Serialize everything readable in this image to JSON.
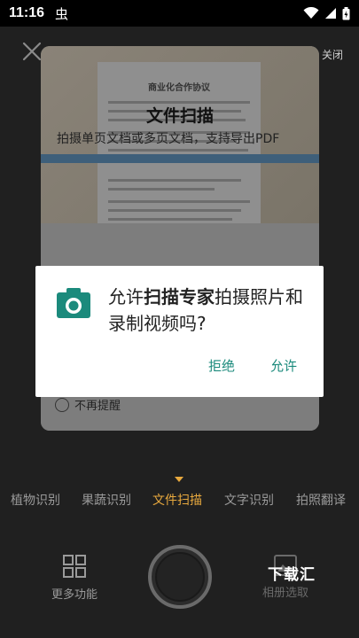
{
  "status_bar": {
    "time": "11:16",
    "bug_icon": "虫"
  },
  "top_bar": {
    "flash_label": "关闭"
  },
  "tutorial": {
    "doc_title": "商业化合作协议",
    "heading": "文件扫描",
    "description": "拍摄单页文档或多页文档，支持导出PDF",
    "no_remind_label": "不再提醒"
  },
  "permission_dialog": {
    "text_prefix": "允许",
    "app_name": "扫描专家",
    "text_suffix": "拍摄照片和录制视频吗?",
    "deny_label": "拒绝",
    "allow_label": "允许",
    "accent_color": "#1b8a7c"
  },
  "modes": {
    "active_index": 2,
    "items": [
      "植物识别",
      "果蔬识别",
      "文件扫描",
      "文字识别",
      "拍照翻译"
    ]
  },
  "bottom": {
    "more_label": "更多功能",
    "album_label": "相册选取",
    "watermark": "下载汇"
  }
}
